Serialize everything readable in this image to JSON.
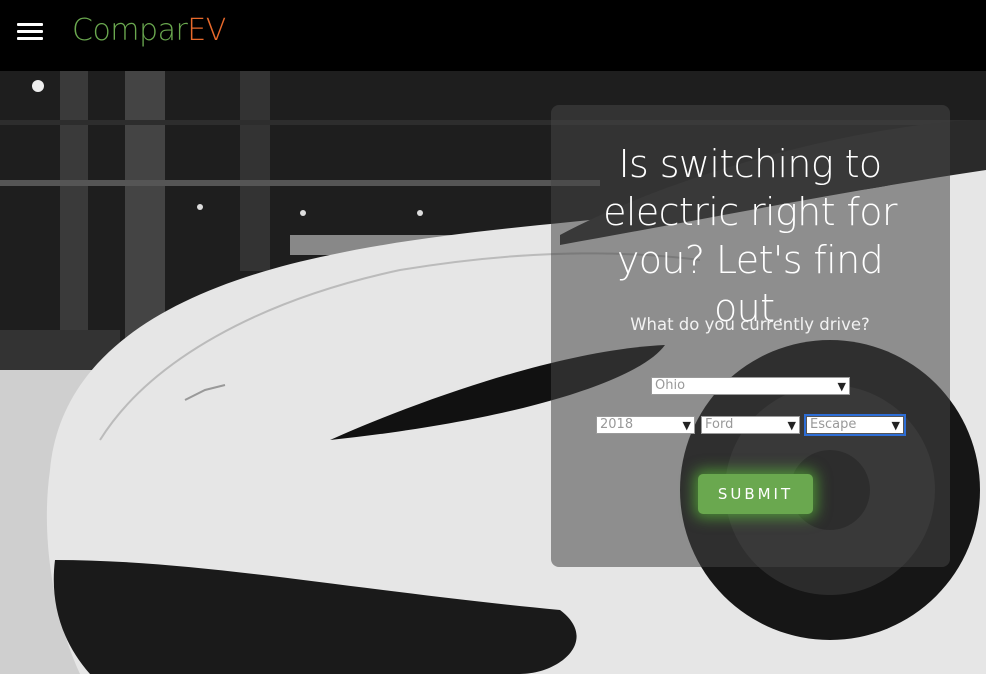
{
  "header": {
    "menu_icon": "hamburger-menu-icon",
    "brand_part1": "Compar",
    "brand_part2": "EV",
    "brand_color1": "#6aa84f",
    "brand_color2": "#e8692b"
  },
  "hero": {
    "headline": "Is switching to electric right for you? Let's find out.",
    "question": "What do you currently drive?",
    "state_select": "Ohio",
    "year_select": "2018",
    "make_select": "Ford",
    "model_select": "Escape",
    "submit_label": "SUBMIT",
    "accent_color": "#6aa84f"
  }
}
